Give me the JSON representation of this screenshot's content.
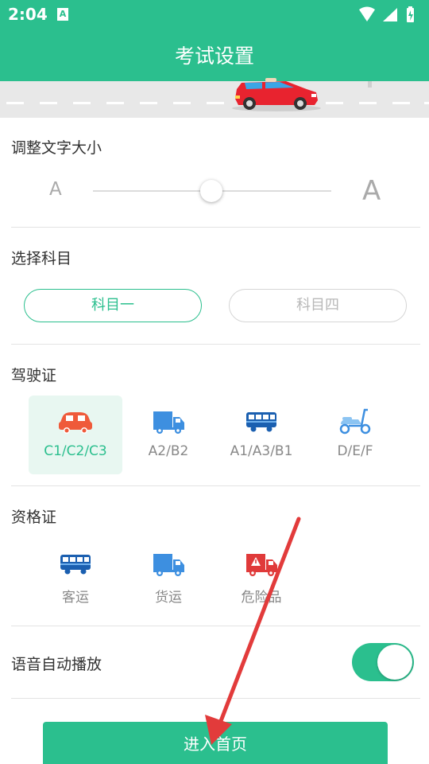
{
  "status": {
    "time": "2:04",
    "app_badge": "A"
  },
  "header": {
    "title": "考试设置"
  },
  "font_size": {
    "title": "调整文字大小",
    "small_label": "A",
    "large_label": "A",
    "level": 0.5
  },
  "subject": {
    "title": "选择科目",
    "options": [
      "科目一",
      "科目四"
    ],
    "selected": "科目一"
  },
  "license": {
    "title": "驾驶证",
    "items": [
      {
        "label": "C1/C2/C3",
        "icon": "car-icon",
        "selected": true
      },
      {
        "label": "A2/B2",
        "icon": "truck-icon",
        "selected": false
      },
      {
        "label": "A1/A3/B1",
        "icon": "bus-icon",
        "selected": false
      },
      {
        "label": "D/E/F",
        "icon": "scooter-icon",
        "selected": false
      }
    ]
  },
  "qualification": {
    "title": "资格证",
    "items": [
      {
        "label": "客运",
        "icon": "bus-icon"
      },
      {
        "label": "货运",
        "icon": "truck-icon"
      },
      {
        "label": "危险品",
        "icon": "hazmat-truck-icon"
      }
    ]
  },
  "voice": {
    "label": "语音自动播放",
    "enabled": true
  },
  "enter_button": {
    "label": "进入首页"
  },
  "colors": {
    "accent": "#2bbf8e",
    "car": "#ef5a3a",
    "vehicle_blue": "#3d8fe0",
    "hazmat": "#e03a3a",
    "arrow": "#e23b3b"
  }
}
